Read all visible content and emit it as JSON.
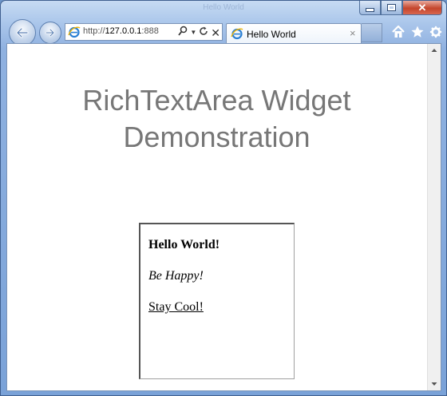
{
  "window": {
    "title": "Hello World"
  },
  "address": {
    "scheme": "http://",
    "host": "127.0.0.1",
    "port": ":888"
  },
  "tab": {
    "label": "Hello World",
    "close": "×"
  },
  "page": {
    "heading_line1": "RichTextArea Widget",
    "heading_line2": "Demonstration",
    "rich_text": {
      "line1": "Hello World!",
      "line2": "Be Happy!",
      "line3": "Stay Cool!"
    }
  },
  "icons": {
    "back": "back-arrow-icon",
    "forward": "forward-arrow-icon",
    "search": "search-icon",
    "refresh": "refresh-icon",
    "stop": "stop-icon",
    "home": "home-icon",
    "favorites": "star-icon",
    "tools": "gear-icon"
  },
  "colors": {
    "heading": "#777777",
    "frame": "#6d95c9",
    "close_button": "#c4452c"
  }
}
